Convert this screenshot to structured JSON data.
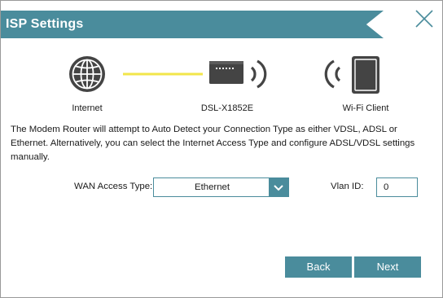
{
  "dialog": {
    "title": "ISP Settings",
    "close_icon": "close-icon"
  },
  "diagram": {
    "internet_label": "Internet",
    "router_label": "DSL-X1852E",
    "client_label": "Wi-Fi Client",
    "icons": [
      "globe-icon",
      "router-icon",
      "wifi-signal-icon",
      "tablet-icon"
    ],
    "link_color": "#f2e64a"
  },
  "description": "The Modem Router will attempt to Auto Detect your Connection Type as either VDSL, ADSL or Ethernet. Alternatively, you can select the Internet Access Type and configure ADSL/VDSL settings manually.",
  "form": {
    "wan_label": "WAN Access Type:",
    "wan_value": "Ethernet",
    "vlan_label": "Vlan ID:",
    "vlan_value": "0"
  },
  "buttons": {
    "back_label": "Back",
    "next_label": "Next"
  },
  "colors": {
    "accent": "#4a8c9c",
    "icon": "#444444"
  }
}
